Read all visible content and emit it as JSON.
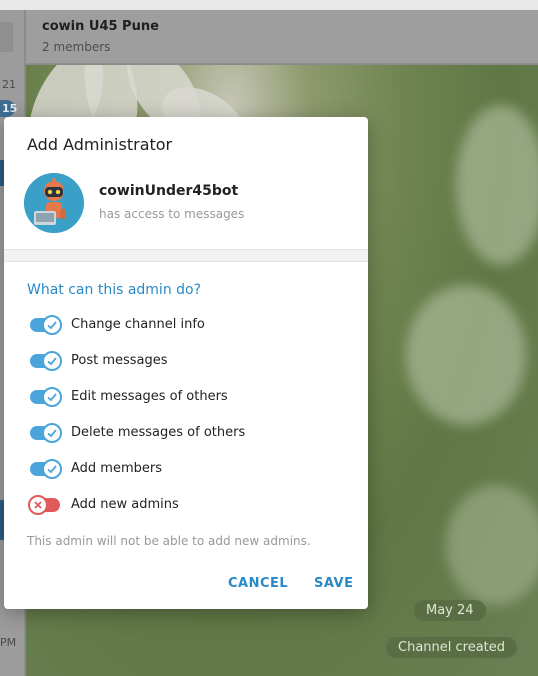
{
  "chat": {
    "title": "cowin U45 Pune",
    "subtitle": "2 members",
    "date_pill": "May 24",
    "service_message": "Channel created"
  },
  "sidebar": {
    "time_partial": "21",
    "badge_partial": "15",
    "time_bottom_partial": "PM"
  },
  "modal": {
    "title": "Add Administrator",
    "bot": {
      "name": "cowinUnder45bot",
      "status": "has access to messages"
    },
    "section_title": "What can this admin do?",
    "permissions": [
      {
        "label": "Change channel info",
        "enabled": true
      },
      {
        "label": "Post messages",
        "enabled": true
      },
      {
        "label": "Edit messages of others",
        "enabled": true
      },
      {
        "label": "Delete messages of others",
        "enabled": true
      },
      {
        "label": "Add members",
        "enabled": true
      },
      {
        "label": "Add new admins",
        "enabled": false
      }
    ],
    "note": "This admin will not be able to add new admins.",
    "cancel_label": "CANCEL",
    "save_label": "SAVE"
  },
  "colors": {
    "accent": "#2a8ac7",
    "toggle_on": "#4ba4dc",
    "toggle_off": "#e05a5a"
  }
}
